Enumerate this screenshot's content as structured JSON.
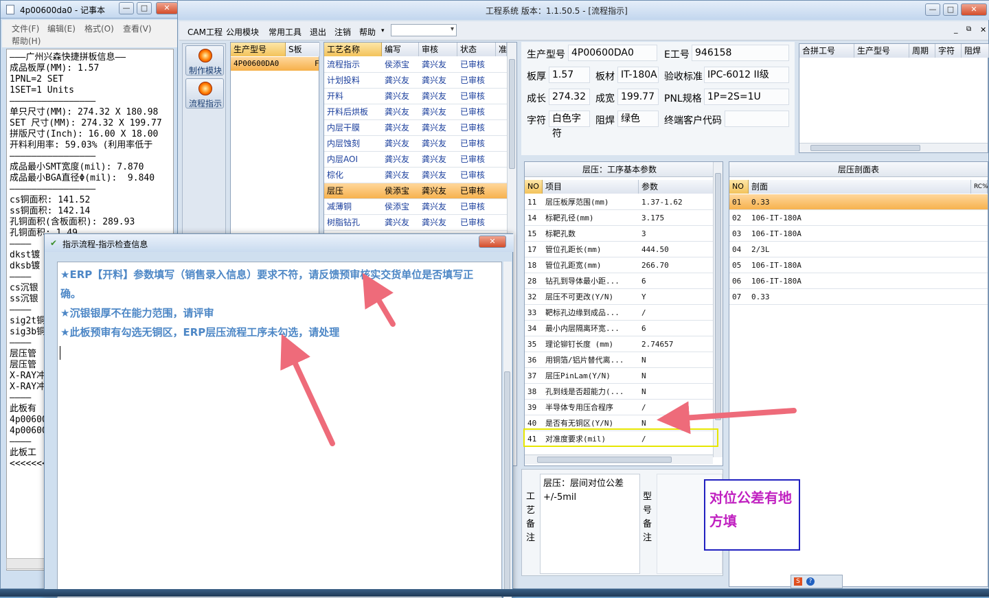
{
  "notepad": {
    "title": "4p00600da0 - 记事本",
    "menu": [
      "文件(F)",
      "编辑(E)",
      "格式(O)",
      "查看(V)",
      "帮助(H)"
    ],
    "lines": [
      "———广州兴森快捷拼板信息——",
      "成品板厚(MM): 1.57",
      "1PNL=2 SET",
      "1SET=1 Units",
      "————————————————",
      "单只尺寸(MM): 274.32 X 180.98",
      "SET 尺寸(MM): 274.32 X 199.77",
      "拼版尺寸(Inch): 16.00 X 18.00",
      "开料利用率: 59.03% (利用率低于",
      "————————————————",
      "成品最小SMT宽度(mil): 7.870",
      "成品最小BGA直径Φ(mil):  9.840",
      "————————————————",
      "cs铜面积: 141.52",
      "ss铜面积: 142.14",
      "孔铜面积(含板面积): 289.93",
      "孔铜面积: 1.49",
      "————",
      "dkst镀",
      "dksb镀",
      "————",
      "cs沉银",
      "ss沉银",
      "————",
      "sig2t铜",
      "sig3b铜",
      "————",
      "层压管",
      "层压管",
      "X-RAY冲",
      "X-RAY冲",
      "————",
      "此板有",
      "4p00600",
      "4p00600",
      "————",
      "此板工",
      "<<<<<<<"
    ]
  },
  "app": {
    "title": "工程系统   版本：1.1.50.5 - [流程指示]",
    "menu": [
      "CAM工程",
      "公用模块",
      "常用工具",
      "退出",
      "注销",
      "帮助"
    ],
    "nav": [
      "制作模块",
      "流程指示"
    ],
    "model_grid": {
      "headers": [
        "生产型号",
        "S板"
      ],
      "rows": [
        [
          "4P00600DA0",
          "F"
        ]
      ]
    },
    "process_grid": {
      "headers": [
        "工艺名称",
        "编写",
        "审核",
        "状态",
        "准"
      ],
      "rows": [
        [
          "流程指示",
          "侯添宝",
          "龚兴友",
          "已审核"
        ],
        [
          "计划投料",
          "龚兴友",
          "龚兴友",
          "已审核"
        ],
        [
          "开料",
          "龚兴友",
          "龚兴友",
          "已审核"
        ],
        [
          "开料后烘板",
          "龚兴友",
          "龚兴友",
          "已审核"
        ],
        [
          "内层干膜",
          "龚兴友",
          "龚兴友",
          "已审核"
        ],
        [
          "内层蚀刻",
          "龚兴友",
          "龚兴友",
          "已审核"
        ],
        [
          "内层AOI",
          "龚兴友",
          "龚兴友",
          "已审核"
        ],
        [
          "棕化",
          "龚兴友",
          "龚兴友",
          "已审核"
        ],
        [
          "层压",
          "侯添宝",
          "龚兴友",
          "已审核"
        ],
        [
          "减薄铜",
          "侯添宝",
          "龚兴友",
          "已审核"
        ],
        [
          "树脂钻孔",
          "龚兴友",
          "龚兴友",
          "已审核"
        ]
      ],
      "selected_row": 8
    },
    "info": {
      "prod_model_label": "生产型号",
      "prod_model": "4P00600DA0",
      "e_no_label": "E工号",
      "e_no": "946158",
      "thickness_label": "板厚",
      "thickness": "1.57",
      "material_label": "板材",
      "material": "IT-180A",
      "standard_label": "验收标准",
      "standard": "IPC-6012 II级",
      "length_label": "成长",
      "length": "274.32",
      "width_label": "成宽",
      "width": "199.77",
      "pnl_label": "PNL规格",
      "pnl": "1P=2S=1U",
      "char_label": "字符",
      "char": "白色字符",
      "mask_label": "阻焊",
      "mask": "绿色",
      "customer_label": "终端客户代码",
      "customer": ""
    },
    "combine_grid": {
      "headers": [
        "合拼工号",
        "生产型号",
        "周期",
        "字符",
        "阻焊"
      ]
    },
    "params": {
      "title": "层压：工序基本参数",
      "headers": [
        "NO",
        "项目",
        "参数"
      ],
      "rows": [
        [
          "11",
          "层压板厚范围(mm)",
          "1.37-1.62"
        ],
        [
          "14",
          "标靶孔径(mm)",
          "3.175"
        ],
        [
          "15",
          "标靶孔数",
          "3"
        ],
        [
          "17",
          "管位孔距长(mm)",
          "444.50"
        ],
        [
          "18",
          "管位孔距宽(mm)",
          "266.70"
        ],
        [
          "28",
          "钻孔到导体最小距...",
          "6"
        ],
        [
          "32",
          "层压不可更改(Y/N)",
          "Y"
        ],
        [
          "33",
          "靶标孔边缘到成品...",
          "/"
        ],
        [
          "34",
          "最小内层隔离环宽...",
          "6"
        ],
        [
          "35",
          "理论铆钉长度 (mm)",
          "2.74657"
        ],
        [
          "36",
          "用铜箔/铝片替代离...",
          "N"
        ],
        [
          "37",
          "层压PinLam(Y/N)",
          "N"
        ],
        [
          "38",
          "孔到线是否超能力(...",
          "N"
        ],
        [
          "39",
          "半导体专用压合程序",
          "/"
        ],
        [
          "40",
          "是否有无铜区(Y/N)",
          "N"
        ],
        [
          "41",
          "对准度要求(mil)",
          "/"
        ]
      ]
    },
    "profile": {
      "title": "层压剖面表",
      "headers": [
        "NO",
        "剖面",
        "RC%"
      ],
      "rows": [
        [
          "01",
          "0.33"
        ],
        [
          "02",
          "106-IT-180A"
        ],
        [
          "03",
          "106-IT-180A"
        ],
        [
          "04",
          "2/3L"
        ],
        [
          "05",
          "106-IT-180A"
        ],
        [
          "06",
          "106-IT-180A"
        ],
        [
          "07",
          "0.33"
        ]
      ]
    },
    "remarks": {
      "process_label": "工艺备注",
      "process_text": "层压：层间对位公差+/-5mil",
      "model_label": "型号备注"
    },
    "annotation": "对位公差有地方填"
  },
  "dialog": {
    "title": "指示流程-指示检查信息",
    "messages": [
      "★ERP【开料】参数填写（销售录入信息）要求不符，请反馈预审核实交货单位是否填写正",
      "确。",
      "★沉银银厚不在能力范围，请评审",
      "★此板预审有勾选无铜区，ERP层压流程工序未勾选，请处理"
    ]
  },
  "colors": {
    "arrow": "#ee6b7a",
    "annotation_border": "#2020c0",
    "annotation_text": "#c020c0",
    "highlight": "#e6e600",
    "message": "#4d87c6"
  }
}
